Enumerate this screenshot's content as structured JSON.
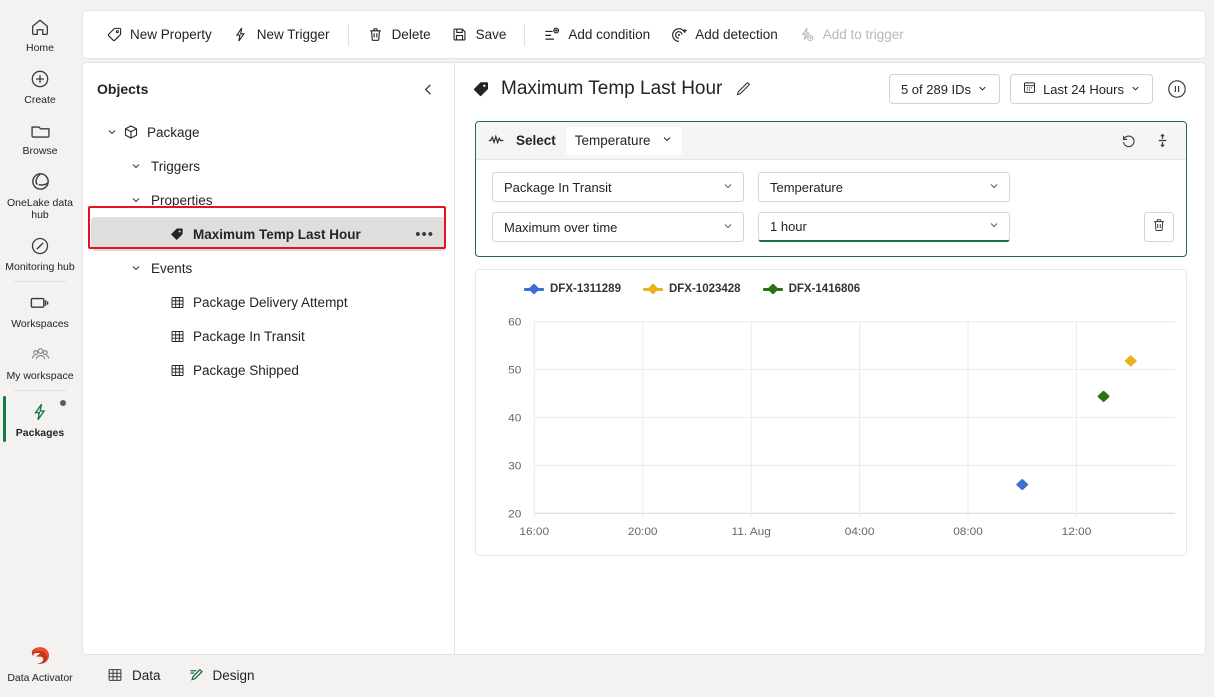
{
  "rail": {
    "items": [
      {
        "label": "Home",
        "icon": "home-icon",
        "active": false
      },
      {
        "label": "Create",
        "icon": "plus-circle-icon",
        "active": false
      },
      {
        "label": "Browse",
        "icon": "folder-icon",
        "active": false
      },
      {
        "label": "OneLake data hub",
        "icon": "onelake-icon",
        "active": false
      },
      {
        "label": "Monitoring hub",
        "icon": "monitoring-icon",
        "active": false
      },
      {
        "label": "Workspaces",
        "icon": "workspaces-icon",
        "active": false
      },
      {
        "label": "My workspace",
        "icon": "people-icon",
        "active": false
      },
      {
        "label": "Packages",
        "icon": "bolt-icon",
        "active": true
      }
    ],
    "bottom": {
      "label": "Data Activator",
      "icon": "data-activator-logo"
    }
  },
  "toolbar": {
    "items": [
      {
        "label": "New Property",
        "icon": "tag-icon",
        "disabled": false
      },
      {
        "label": "New Trigger",
        "icon": "bolt-icon",
        "disabled": false
      },
      {
        "label": "Delete",
        "icon": "trash-icon",
        "disabled": false
      },
      {
        "label": "Save",
        "icon": "save-icon",
        "disabled": false
      },
      {
        "label": "Add condition",
        "icon": "add-condition-icon",
        "disabled": false
      },
      {
        "label": "Add detection",
        "icon": "add-detection-icon",
        "disabled": false
      },
      {
        "label": "Add to trigger",
        "icon": "add-to-trigger-icon",
        "disabled": true
      }
    ]
  },
  "objects_panel": {
    "title": "Objects",
    "collapse_icon": "chevron-left-icon",
    "tree": [
      {
        "label": "Package",
        "icon": "cube-icon",
        "depth": 0,
        "expanded": true,
        "selected": false,
        "more": false
      },
      {
        "label": "Triggers",
        "icon": "none",
        "depth": 1,
        "expanded": true,
        "selected": false,
        "more": false
      },
      {
        "label": "Properties",
        "icon": "none",
        "depth": 1,
        "expanded": true,
        "selected": false,
        "more": false
      },
      {
        "label": "Maximum Temp Last Hour",
        "icon": "tag-filled-icon",
        "depth": 3,
        "expanded": null,
        "selected": true,
        "more": true
      },
      {
        "label": "Events",
        "icon": "none",
        "depth": 1,
        "expanded": true,
        "selected": false,
        "more": false
      },
      {
        "label": "Package Delivery Attempt",
        "icon": "table-icon",
        "depth": 3,
        "expanded": null,
        "selected": false,
        "more": false
      },
      {
        "label": "Package In Transit",
        "icon": "table-icon",
        "depth": 3,
        "expanded": null,
        "selected": false,
        "more": false
      },
      {
        "label": "Package Shipped",
        "icon": "table-icon",
        "depth": 3,
        "expanded": null,
        "selected": false,
        "more": false
      }
    ]
  },
  "detail": {
    "title": "Maximum Temp Last Hour",
    "title_icon": "tag-filled-icon",
    "edit_icon": "pencil-icon",
    "ids_pill": {
      "label": "5 of 289 IDs",
      "chevron": "chevron-down-icon"
    },
    "time_pill": {
      "label": "Last 24 Hours",
      "icon": "calendar-icon",
      "chevron": "chevron-down-icon"
    },
    "pause_icon": "pause-circle-icon"
  },
  "query": {
    "sparkline_icon": "sparkline-icon",
    "select_label": "Select",
    "select_value": "Temperature",
    "reset_icon": "undo-icon",
    "axis_icon": "axis-scale-icon",
    "delete_icon": "trash-icon",
    "dropdowns": [
      {
        "value": "Package In Transit",
        "underlined": false,
        "name": "event-dropdown"
      },
      {
        "value": "Temperature",
        "underlined": false,
        "name": "column-dropdown"
      },
      {
        "value": "Maximum over time",
        "underlined": false,
        "name": "aggregation-dropdown"
      },
      {
        "value": "1 hour",
        "underlined": true,
        "name": "window-dropdown"
      }
    ]
  },
  "chart_data": {
    "type": "scatter",
    "title": "",
    "xlabel": "",
    "ylabel": "",
    "ylim": [
      20,
      60
    ],
    "yticks": [
      20,
      30,
      40,
      50,
      60
    ],
    "xticks": [
      "16:00",
      "20:00",
      "11. Aug",
      "04:00",
      "08:00",
      "12:00"
    ],
    "grid": true,
    "legend_position": "top-left",
    "colors": {
      "DFX-1311289": "#3c6fd1",
      "DFX-1023428": "#e8b21a",
      "DFX-1416806": "#2c7114"
    },
    "series": [
      {
        "name": "DFX-1311289",
        "color": "#3c6fd1",
        "points": [
          {
            "x": "10:00",
            "y": 26.0
          }
        ]
      },
      {
        "name": "DFX-1023428",
        "color": "#e8b21a",
        "points": [
          {
            "x": "14:00",
            "y": 51.8
          }
        ]
      },
      {
        "name": "DFX-1416806",
        "color": "#2c7114",
        "points": [
          {
            "x": "13:00",
            "y": 44.4
          }
        ]
      }
    ]
  },
  "bottom_tabs": [
    {
      "label": "Data",
      "icon": "table-icon",
      "active": false
    },
    {
      "label": "Design",
      "icon": "design-pen-icon",
      "active": false
    }
  ],
  "colors": {
    "accent_green": "#107c41",
    "query_border": "#1d6f42",
    "selection_ring": "#e81123",
    "series_blue": "#3c6fd1",
    "series_yellow": "#e8b21a",
    "series_green": "#2c7114"
  }
}
